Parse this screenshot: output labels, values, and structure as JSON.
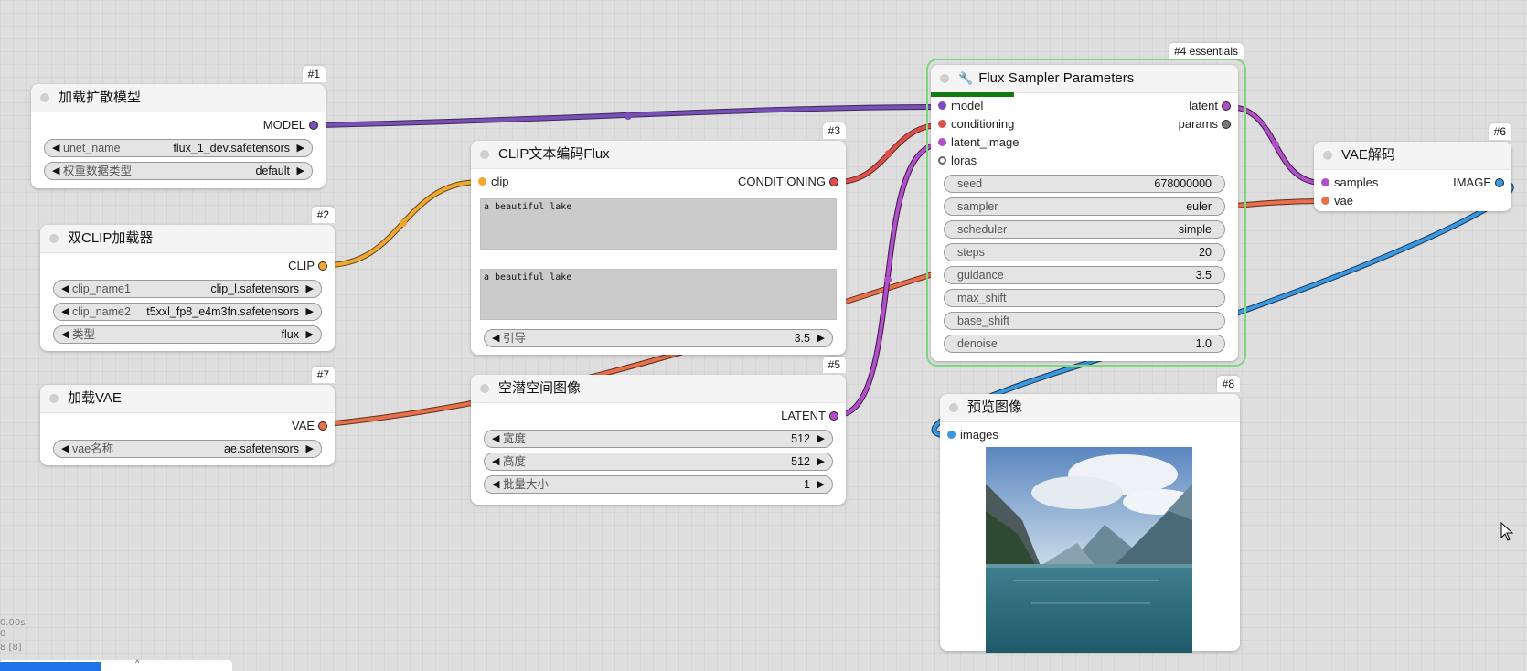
{
  "colors": {
    "model": "#7b4fb8",
    "clip": "#f0a830",
    "conditioning": "#e0504a",
    "vae": "#e8704a",
    "latent": "#b04fc8",
    "image": "#3a98e0",
    "selection": "#7fd67f",
    "progress": "#107b10"
  },
  "nodes": {
    "load_diffusion": {
      "badge": "#1",
      "title": "加载扩散模型",
      "output": "MODEL",
      "widgets": [
        {
          "label": "unet_name",
          "value": "flux_1_dev.safetensors"
        },
        {
          "label": "权重数据类型",
          "value": "default"
        }
      ]
    },
    "dual_clip": {
      "badge": "#2",
      "title": "双CLIP加载器",
      "output": "CLIP",
      "widgets": [
        {
          "label": "clip_name1",
          "value": "clip_l.safetensors"
        },
        {
          "label": "clip_name2",
          "value": "t5xxl_fp8_e4m3fn.safetensors"
        },
        {
          "label": "类型",
          "value": "flux"
        }
      ]
    },
    "load_vae": {
      "badge": "#7",
      "title": "加载VAE",
      "output": "VAE",
      "widgets": [
        {
          "label": "vae名称",
          "value": "ae.safetensors"
        }
      ]
    },
    "clip_encode": {
      "badge": "#3",
      "title": "CLIP文本编码Flux",
      "input": "clip",
      "output": "CONDITIONING",
      "text1": "a beautiful lake",
      "text2": "a beautiful lake",
      "widgets": [
        {
          "label": "引导",
          "value": "3.5"
        }
      ]
    },
    "latent_image": {
      "badge": "#5",
      "title": "空潜空间图像",
      "output": "LATENT",
      "widgets": [
        {
          "label": "宽度",
          "value": "512"
        },
        {
          "label": "高度",
          "value": "512"
        },
        {
          "label": "批量大小",
          "value": "1"
        }
      ]
    },
    "sampler": {
      "badge": "#4 essentials",
      "title": "Flux Sampler Parameters",
      "icon": "wrench-icon",
      "progress": 0.27,
      "inputs": [
        "model",
        "conditioning",
        "latent_image",
        "loras"
      ],
      "outputs": [
        "latent",
        "params"
      ],
      "widgets": [
        {
          "label": "seed",
          "value": "678000000"
        },
        {
          "label": "sampler",
          "value": "euler"
        },
        {
          "label": "scheduler",
          "value": "simple"
        },
        {
          "label": "steps",
          "value": "20"
        },
        {
          "label": "guidance",
          "value": "3.5"
        },
        {
          "label": "max_shift",
          "value": ""
        },
        {
          "label": "base_shift",
          "value": ""
        },
        {
          "label": "denoise",
          "value": "1.0"
        }
      ]
    },
    "vae_decode": {
      "badge": "#6",
      "title": "VAE解码",
      "inputs": [
        "samples",
        "vae"
      ],
      "output": "IMAGE"
    },
    "preview": {
      "badge": "#8",
      "title": "预览图像",
      "input": "images"
    }
  },
  "stats": {
    "line1": "0.00s",
    "line2": "0",
    "line3": "8 [8]"
  }
}
